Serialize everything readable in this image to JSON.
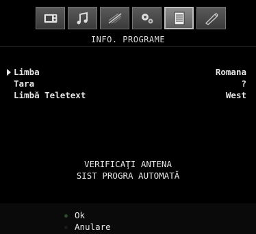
{
  "menu": {
    "title": "INFO. PROGRAME",
    "icons": [
      {
        "name": "picture-icon"
      },
      {
        "name": "sound-icon"
      },
      {
        "name": "settings-icon"
      },
      {
        "name": "features-icon"
      },
      {
        "name": "info-programe-icon"
      },
      {
        "name": "installation-icon"
      }
    ],
    "active_index": 4
  },
  "settings": [
    {
      "label": "Limba",
      "value": "Romana"
    },
    {
      "label": "Tara",
      "value": "?"
    },
    {
      "label": "Limbă Teletext",
      "value": "West"
    }
  ],
  "message": {
    "line1": "VERIFICAŢI ANTENA",
    "line2": "SIST PROGRA AUTOMATĂ"
  },
  "footer": {
    "ok_label": "Ok",
    "cancel_label": "Anulare"
  }
}
